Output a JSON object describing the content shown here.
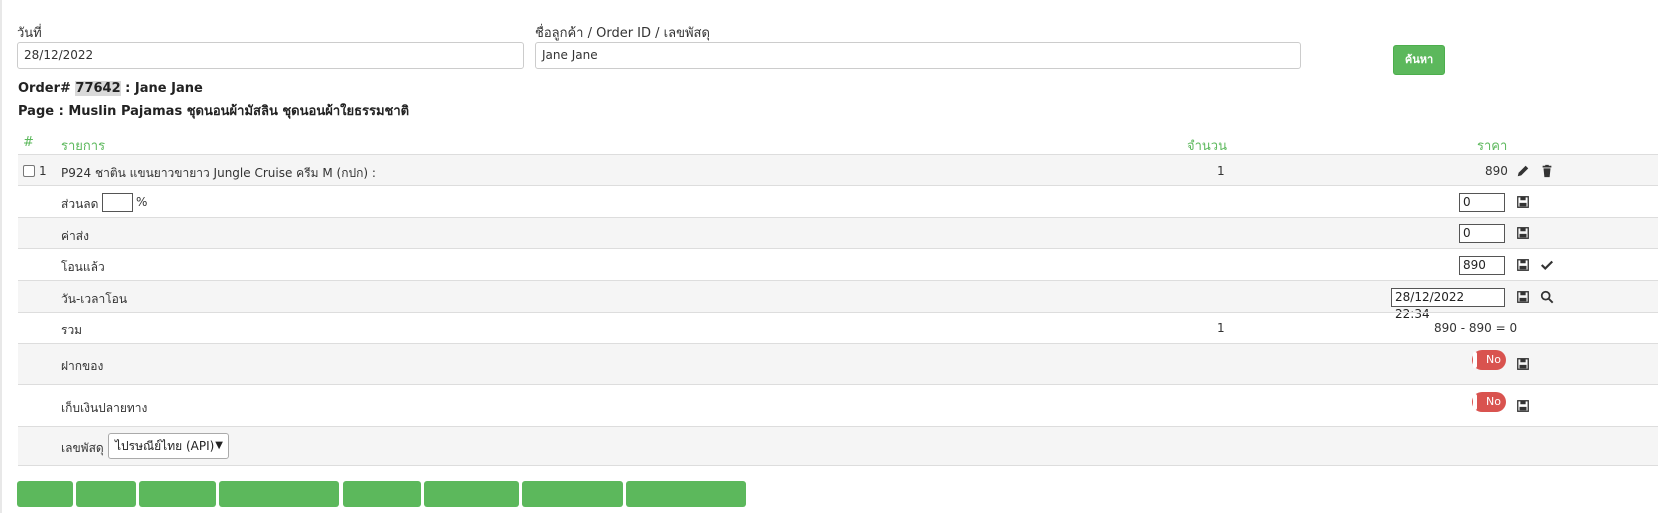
{
  "search": {
    "date_label": "วันที่",
    "date_value": "28/12/2022",
    "query_label": "ชื่อลูกค้า / Order ID / เลขพัสดุ",
    "query_value": "Jane Jane",
    "search_button": "ค้นหา"
  },
  "order": {
    "prefix": "Order# ",
    "id": "77642",
    "customer": " : Jane Jane",
    "page_line": "Page : Muslin Pajamas ชุดนอนผ้ามัสลิน ชุดนอนผ้าใยธรรมชาติ"
  },
  "table": {
    "headers": {
      "num": "#",
      "item": "รายการ",
      "qty": "จำนวน",
      "price": "ราคา"
    },
    "item": {
      "index": "1",
      "name": "P924 ชาติน แขนยาวขายาว Jungle Cruise ครีม M (กปก) :",
      "qty": "1",
      "price": "890"
    },
    "discount": {
      "label": "ส่วนลด",
      "percent_value": "",
      "percent_sign": "%",
      "value": "0"
    },
    "shipping": {
      "label": "ค่าส่ง",
      "value": "0"
    },
    "transferred": {
      "label": "โอนแล้ว",
      "value": "890"
    },
    "transfer_time": {
      "label": "วัน-เวลาโอน",
      "value": "28/12/2022 22:34"
    },
    "total": {
      "label": "รวม",
      "qty": "1",
      "formula": "890 - 890 = 0"
    },
    "deposit": {
      "label": "ฝากของ",
      "toggle": "No"
    },
    "cod": {
      "label": "เก็บเงินปลายทาง",
      "toggle": "No"
    },
    "tracking": {
      "label": "เลขพัสดุ",
      "carrier": "ไปรษณีย์ไทย (API)"
    }
  },
  "colors": {
    "accent": "#5cb85c",
    "danger": "#d9534f",
    "row_alt": "#f5f5f5"
  },
  "icons": [
    "pencil-icon",
    "trash-icon",
    "save-icon",
    "check-icon",
    "search-icon",
    "chevron-down-icon"
  ]
}
